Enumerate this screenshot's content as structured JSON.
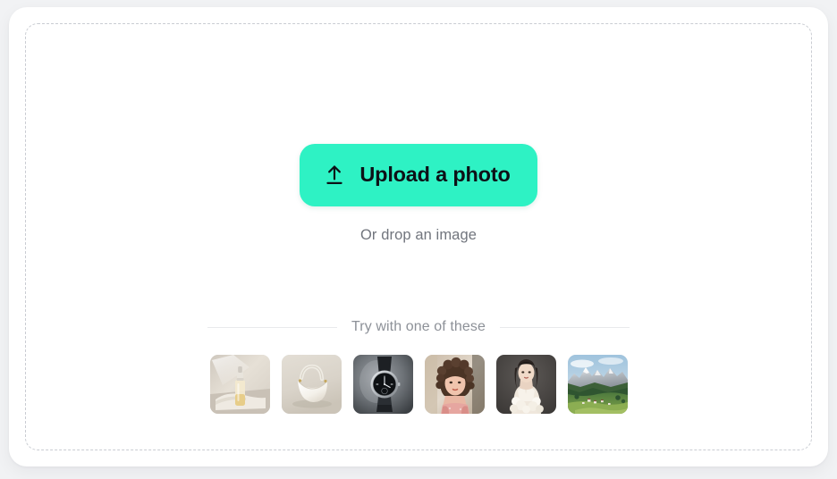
{
  "uploader": {
    "button": {
      "label": "Upload a photo",
      "icon": "upload-arrow-icon",
      "color": "#2ef2c4",
      "text_color": "#0d1117"
    },
    "drop_hint": "Or drop an image",
    "dropzone": {
      "border_style": "dashed",
      "border_color": "#c9ccd2"
    },
    "card": {
      "background": "#ffffff",
      "page_background": "#f1f2f4"
    }
  },
  "samples": {
    "title": "Try with one of these",
    "divider_color": "#e9eaec",
    "items": [
      {
        "name": "serum-dropper-bottle",
        "alt": "Cosmetic serum bottle with dropper on folded cloth"
      },
      {
        "name": "white-crescent-handbag",
        "alt": "White crescent shoulder bag on beige backdrop"
      },
      {
        "name": "black-dial-wristwatch",
        "alt": "Wristwatch with black dial and leather strap"
      },
      {
        "name": "curly-hair-portrait",
        "alt": "Portrait of woman with curly hair in floral top"
      },
      {
        "name": "bride-with-bouquet",
        "alt": "Woman in white dress holding flowers on dark backdrop"
      },
      {
        "name": "mountain-valley-landscape",
        "alt": "Alpine valley with village and rocky peaks"
      }
    ]
  }
}
